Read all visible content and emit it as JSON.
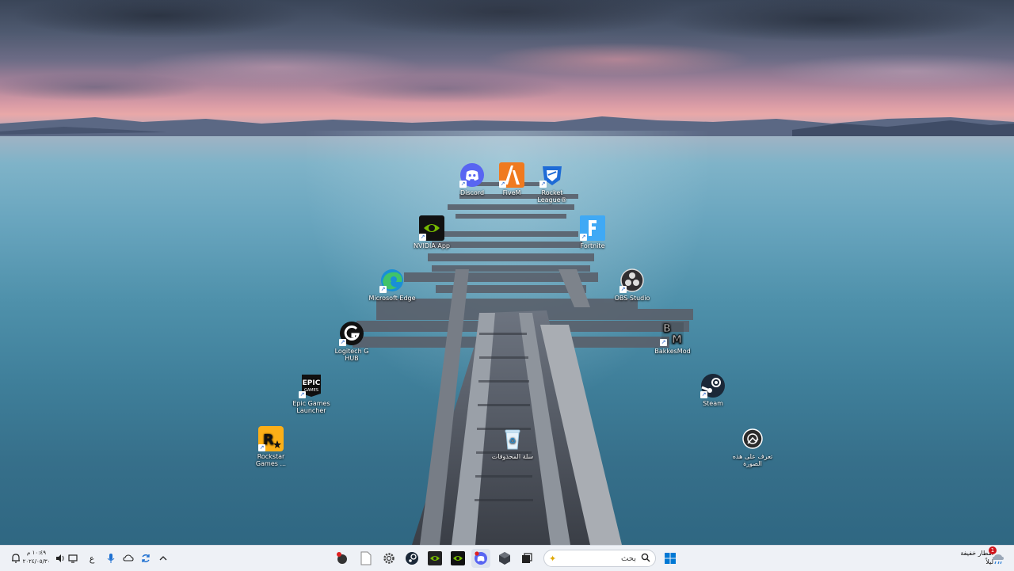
{
  "desktop": {
    "icons": {
      "discord": "Discord",
      "fivem": "FiveM",
      "rocket_league": "Rocket League®",
      "nvidia": "NVIDIA App",
      "fortnite": "Fortnite",
      "edge": "Microsoft Edge",
      "obs": "OBS Studio",
      "logitech": "Logitech G HUB",
      "bakkesmod": "BakkesMod",
      "epic": "Epic Games Launcher",
      "steam": "Steam",
      "rockstar": "Rockstar Games ...",
      "recycle_bin": "سلة المحذوفات",
      "learn_picture": "تعرف على هذه الصورة"
    }
  },
  "taskbar": {
    "search_placeholder": "بحث",
    "clock_time": "١٠:٤٩ م",
    "clock_date": "٢٠٢٤/٠٥/٣٠",
    "input_language": "ع",
    "weather_line1": "أمطار خفيفة",
    "weather_line2": "ليلاً",
    "weather_badge": "1"
  },
  "colors": {
    "taskbar_bg": "#eef1f6",
    "discord": "#5865f2",
    "fivem": "#f07a1f",
    "nvidia": "#76b900",
    "windows_blue": "#0078d4"
  }
}
